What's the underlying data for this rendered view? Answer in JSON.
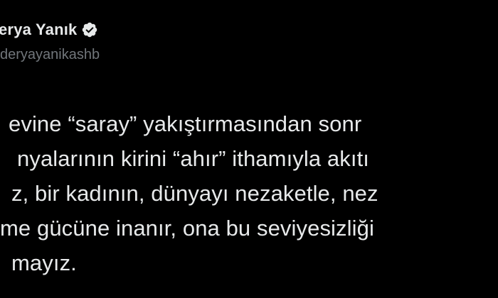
{
  "author": {
    "display_name": "erya Yanık",
    "handle": "deryayanikashb",
    "verified_icon": "verified-badge-icon"
  },
  "tweet": {
    "lines": [
      "evine “saray” yakıştırmasından sonr",
      "nyalarının kirini “ahır” ithamıyla akıtı",
      "z, bir kadının, dünyayı nezaketle, nez",
      "me gücüne inanır, ona bu seviyesizliği",
      "mayız."
    ]
  },
  "colors": {
    "background": "#000000",
    "text": "#e7e9ea",
    "secondary_text": "#71767b",
    "badge": "#e7e9ea"
  }
}
